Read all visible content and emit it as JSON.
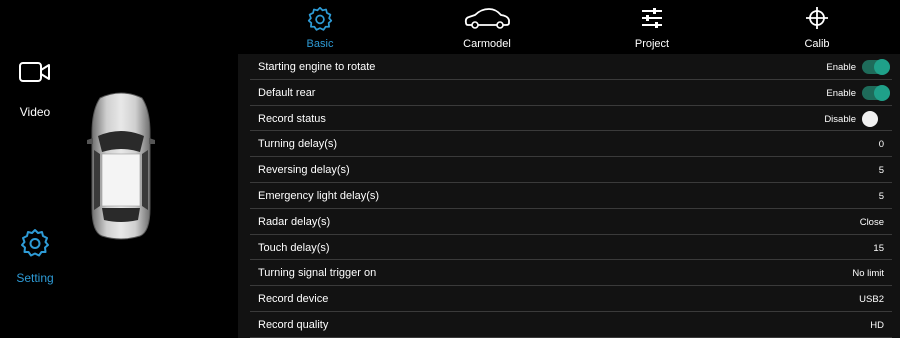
{
  "sidebar": {
    "items": [
      {
        "label": "Video",
        "icon": "video-camera-icon"
      },
      {
        "label": "Setting",
        "icon": "gear-icon",
        "active": true
      }
    ]
  },
  "tabs": [
    {
      "label": "Basic",
      "icon": "gear-icon",
      "active": true
    },
    {
      "label": "Carmodel",
      "icon": "car-outline-icon"
    },
    {
      "label": "Project",
      "icon": "sliders-icon"
    },
    {
      "label": "Calib",
      "icon": "crosshair-icon"
    }
  ],
  "settings": [
    {
      "name": "Starting engine to rotate",
      "value": "Enable",
      "toggle": "on"
    },
    {
      "name": "Default rear",
      "value": "Enable",
      "toggle": "on"
    },
    {
      "name": "Record status",
      "value": "Disable",
      "toggle": "off"
    },
    {
      "name": "Turning delay(s)",
      "value": "0"
    },
    {
      "name": "Reversing delay(s)",
      "value": "5"
    },
    {
      "name": "Emergency light delay(s)",
      "value": "5"
    },
    {
      "name": "Radar delay(s)",
      "value": "Close"
    },
    {
      "name": "Touch delay(s)",
      "value": "15"
    },
    {
      "name": "Turning signal trigger on",
      "value": "No limit"
    },
    {
      "name": "Record device",
      "value": "USB2"
    },
    {
      "name": "Record quality",
      "value": "HD"
    }
  ],
  "colors": {
    "accent": "#2e9bd6",
    "toggle_on": "#1fa089",
    "background": "#000000",
    "panel": "#121212",
    "divider": "#3a3a3a"
  }
}
